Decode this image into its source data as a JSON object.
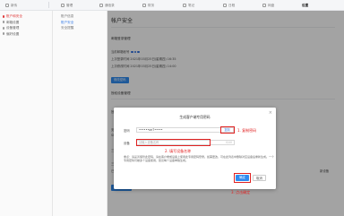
{
  "topnav": {
    "items": [
      {
        "label": "新传",
        "active": false
      },
      {
        "label": "管理",
        "active": false
      },
      {
        "label": "通信录",
        "active": false
      },
      {
        "label": "财务",
        "active": false
      },
      {
        "label": "笔记",
        "active": false
      },
      {
        "label": "日程",
        "active": false
      },
      {
        "label": "网盘",
        "active": false
      },
      {
        "label": "设置",
        "active": true
      }
    ]
  },
  "sidebar": {
    "items": [
      {
        "label": "账户和安全",
        "active": true
      },
      {
        "label": "邮箱设置",
        "active": false
      },
      {
        "label": "设备管理",
        "active": false
      },
      {
        "label": "偏好设置",
        "active": false
      }
    ]
  },
  "subnav": {
    "items": [
      {
        "label": "账户信息",
        "active": false
      },
      {
        "label": "账户安全",
        "active": true
      },
      {
        "label": "安全提醒",
        "active": false
      }
    ]
  },
  "main": {
    "title": "帐户安全",
    "section1": "邮箱登录管理",
    "row_login_type": "当前邮箱帐号",
    "row_last_login": "上次登录时间 2021年03月25日(星期四) 16:35",
    "row_last_change": "上次修改时间 2021年03月25日(星期四) 14:00",
    "modify_button": "修改密码",
    "section2": "授权设备管理",
    "row_a": "授权码登录管理",
    "row_b": "安全专用密码",
    "row_b2": "SDK",
    "row_c": "三方客户端登录",
    "row_d": "三方客户端密码",
    "row_e": "已启用",
    "side_link": "新设备",
    "generate_button": "生成授权码"
  },
  "dialog": {
    "title": "生成客户端专用密码",
    "close": "×",
    "password_label": "密码",
    "password_value": "••••••ae7•••••",
    "copy_label": "复制",
    "step1": "1. 复制密码",
    "device_label": "设备",
    "device_placeholder": "请输入设备名称",
    "device_counter": "0/40",
    "step2": "2. 填写设备名称",
    "note": "重点：请妥善保管此密码，请在客户端或设备上使用此专用密码登录。如需更改，可在此列表中删除对应设备后重新生成。一个专用密码可被多个设备使用，建议每个设备单独生成。",
    "ok_label": "确定",
    "cancel_label": "取消",
    "step3": "3. 点击确定"
  },
  "colors": {
    "accent": "#2f8bf0",
    "highlight": "#e02020",
    "active_sidebar": "#e03b3b"
  }
}
